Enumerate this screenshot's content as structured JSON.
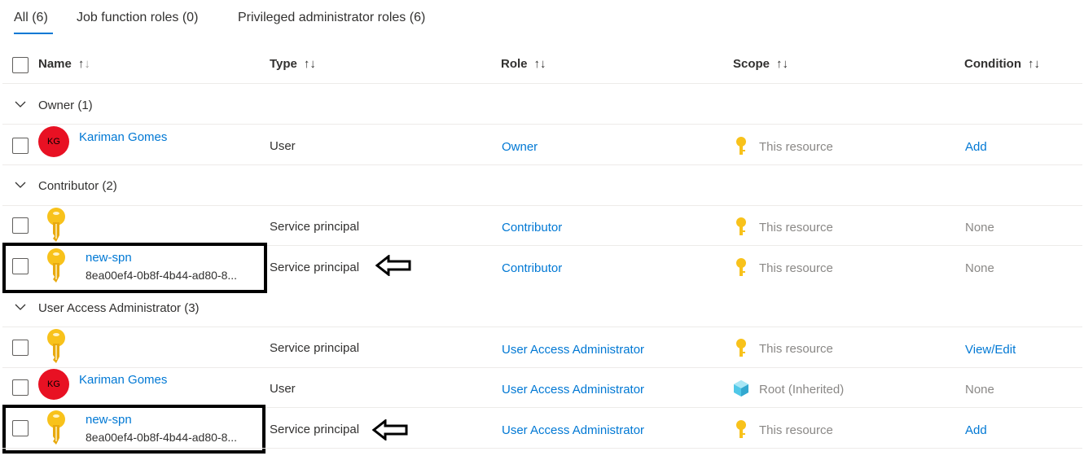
{
  "tabs": [
    {
      "label": "All (6)",
      "active": true
    },
    {
      "label": "Job function roles (0)",
      "active": false
    },
    {
      "label": "Privileged administrator roles (6)",
      "active": false
    }
  ],
  "columns": {
    "name": "Name",
    "type": "Type",
    "role": "Role",
    "scope": "Scope",
    "condition": "Condition"
  },
  "sort_glyph": "↑↓",
  "groups": [
    {
      "label": "Owner (1)"
    },
    {
      "label": "Contributor (2)"
    },
    {
      "label": "User Access Administrator (3)"
    }
  ],
  "rows": [
    {
      "avatar": "KG",
      "name": "Kariman Gomes",
      "type": "User",
      "role": "Owner",
      "scope": "This resource",
      "condition": "Add"
    },
    {
      "name": "",
      "type": "Service principal",
      "role": "Contributor",
      "scope": "This resource",
      "condition": "None"
    },
    {
      "name": "new-spn",
      "id": "8ea00ef4-0b8f-4b44-ad80-8...",
      "type": "Service principal",
      "role": "Contributor",
      "scope": "This resource",
      "condition": "None"
    },
    {
      "name": "",
      "type": "Service principal",
      "role": "User Access Administrator",
      "scope": "This resource",
      "condition": "View/Edit"
    },
    {
      "avatar": "KG",
      "name": "Kariman Gomes",
      "type": "User",
      "role": "User Access Administrator",
      "scope": "Root (Inherited)",
      "condition": "None"
    },
    {
      "name": "new-spn",
      "id": "8ea00ef4-0b8f-4b44-ad80-8...",
      "type": "Service principal",
      "role": "User Access Administrator",
      "scope": "This resource",
      "condition": "Add"
    }
  ],
  "colors": {
    "link": "#0078d4",
    "avatar_bg": "#e81123",
    "key": "#f8c21b"
  },
  "icons": {
    "key": "key-icon",
    "scope": "scope-key-icon",
    "root": "management-group-cube-icon",
    "arrow": "left-arrow-icon"
  }
}
